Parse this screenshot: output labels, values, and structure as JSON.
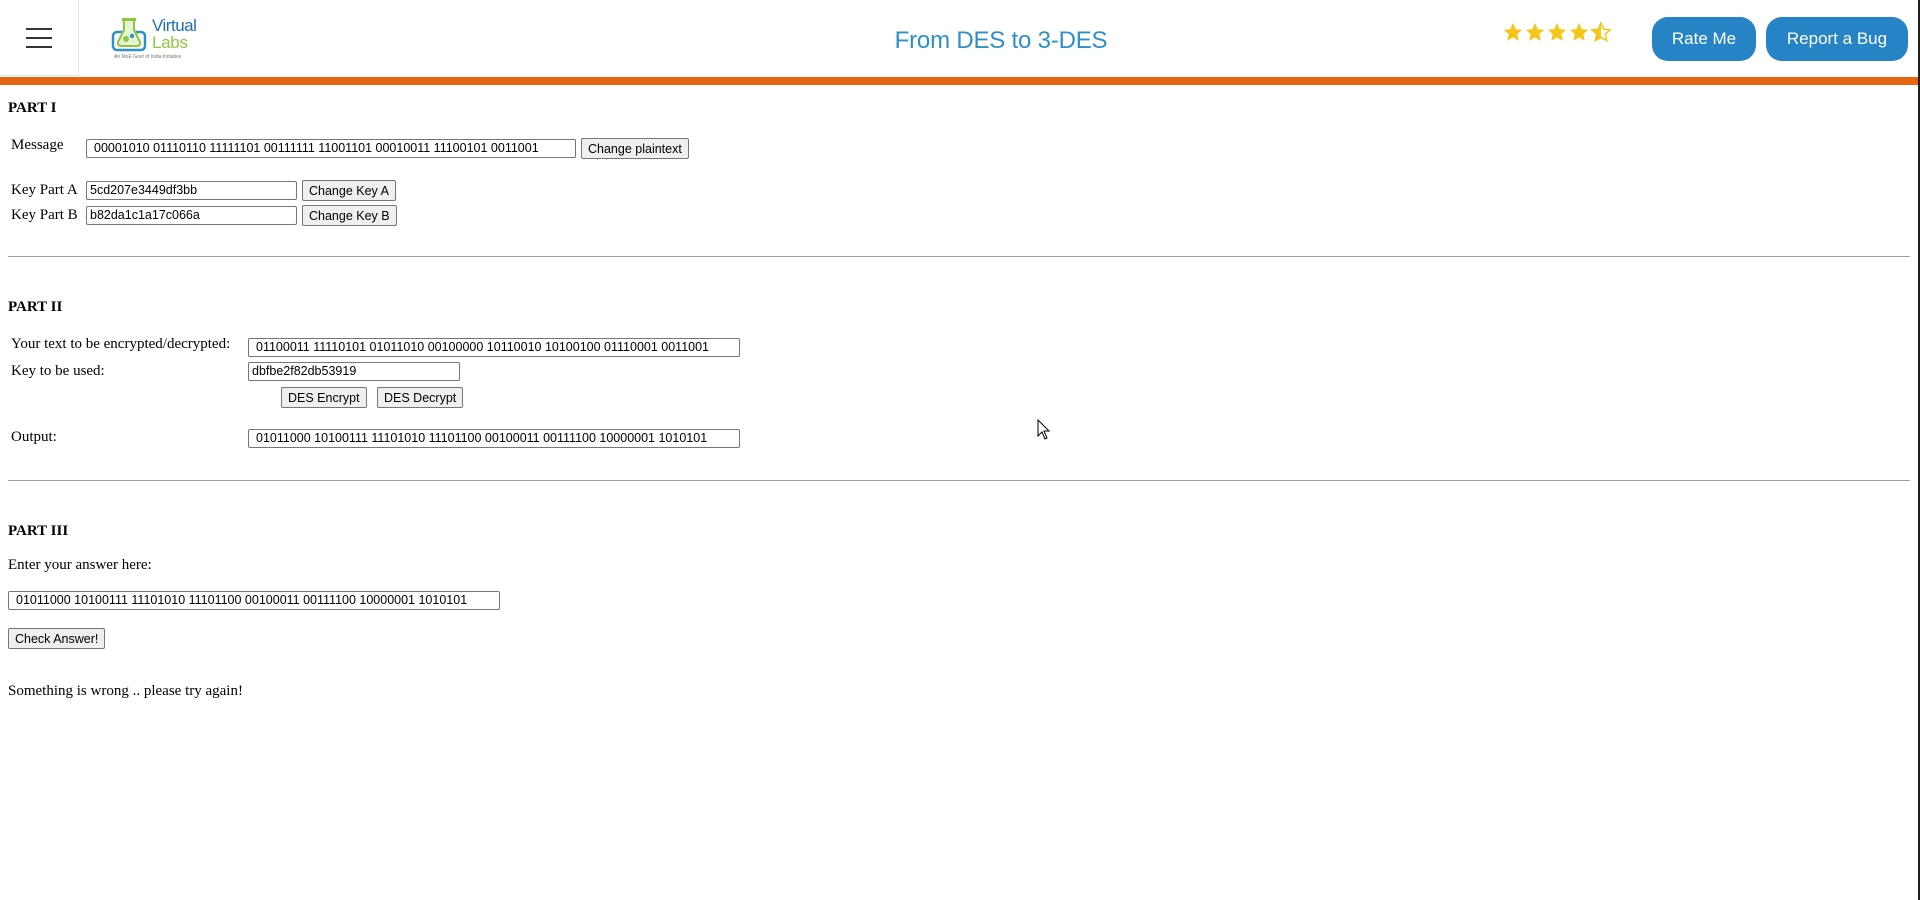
{
  "header": {
    "menu_icon": "hamburger-menu-icon",
    "logo": {
      "word1": "Virtual",
      "word2": "Labs",
      "tagline": "An MoE Govt of India Initiative"
    },
    "title": "From DES to 3-DES",
    "rating_value": 4.5,
    "rating_max": 5,
    "rate_label": "Rate Me",
    "bug_label": "Report a Bug",
    "accent_color": "#e8650f",
    "button_color": "#2683c6"
  },
  "part1": {
    "title": "PART I",
    "message_label": "Message",
    "message_value": "00001010 01110110 11111101 00111111 11001101 00010011 11100101 0011001",
    "change_plaintext_label": "Change plaintext",
    "keyA_label": "Key Part A",
    "keyA_value": "5cd207e3449df3bb",
    "change_keyA_label": "Change Key A",
    "keyB_label": "Key Part B",
    "keyB_value": "b82da1c1a17c066a",
    "change_keyB_label": "Change Key B"
  },
  "part2": {
    "title": "PART II",
    "text_label": "Your text to be encrypted/decrypted:",
    "text_value": "01100011 11110101 01011010 00100000 10110010 10100100 01110001 0011001",
    "key_label": "Key to be used:",
    "key_value": "dbfbe2f82db53919",
    "encrypt_label": "DES Encrypt",
    "decrypt_label": "DES Decrypt",
    "output_label": "Output:",
    "output_value": "01011000 10100111 11101010 11101100 00100011 00111100 10000001 1010101"
  },
  "part3": {
    "title": "PART III",
    "answer_label": "Enter your answer here:",
    "answer_value": "01011000 10100111 11101010 11101100 00100011 00111100 10000001 1010101",
    "check_label": "Check Answer!",
    "result_text": "Something is wrong .. please try again!"
  }
}
